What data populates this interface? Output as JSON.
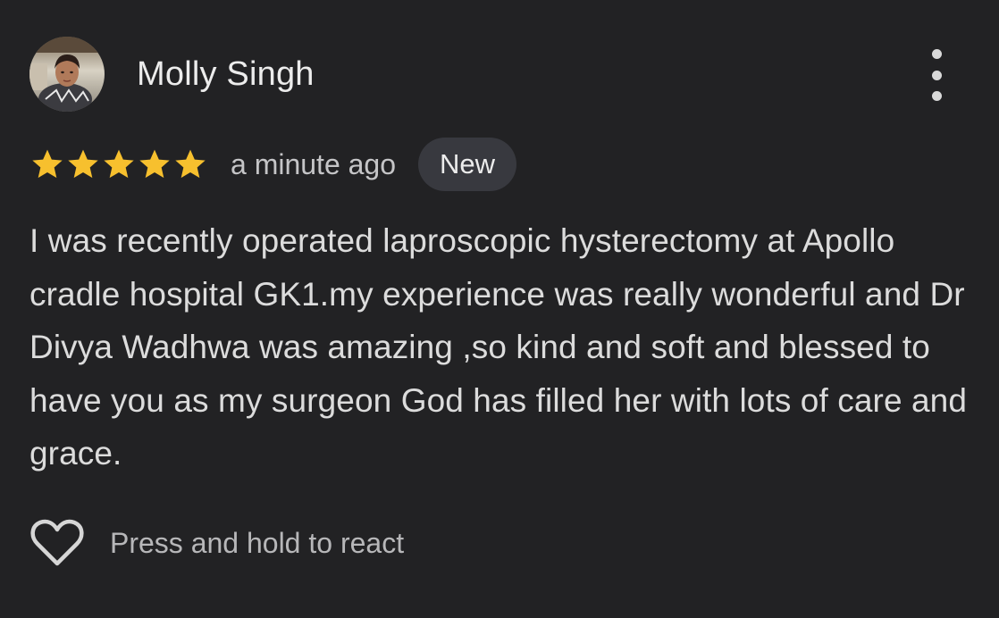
{
  "review": {
    "reviewer_name": "Molly Singh",
    "avatar_icon": "profile-photo",
    "rating": 5,
    "rating_max": 5,
    "star_color": "#f7c02e",
    "timestamp": "a minute ago",
    "badge": "New",
    "text": "I was recently operated laproscopic hysterectomy at Apollo cradle hospital GK1.my experience was really wonderful and Dr Divya Wadhwa was amazing ,so kind and soft and blessed to have you as my surgeon God has filled her with lots of care and grace.",
    "more_icon": "more-vert-icon"
  },
  "reaction": {
    "icon": "heart-outline-icon",
    "hint": "Press and hold to react"
  },
  "colors": {
    "background": "#222224",
    "badge_background": "#38393f",
    "text": "#dcdcdc"
  }
}
